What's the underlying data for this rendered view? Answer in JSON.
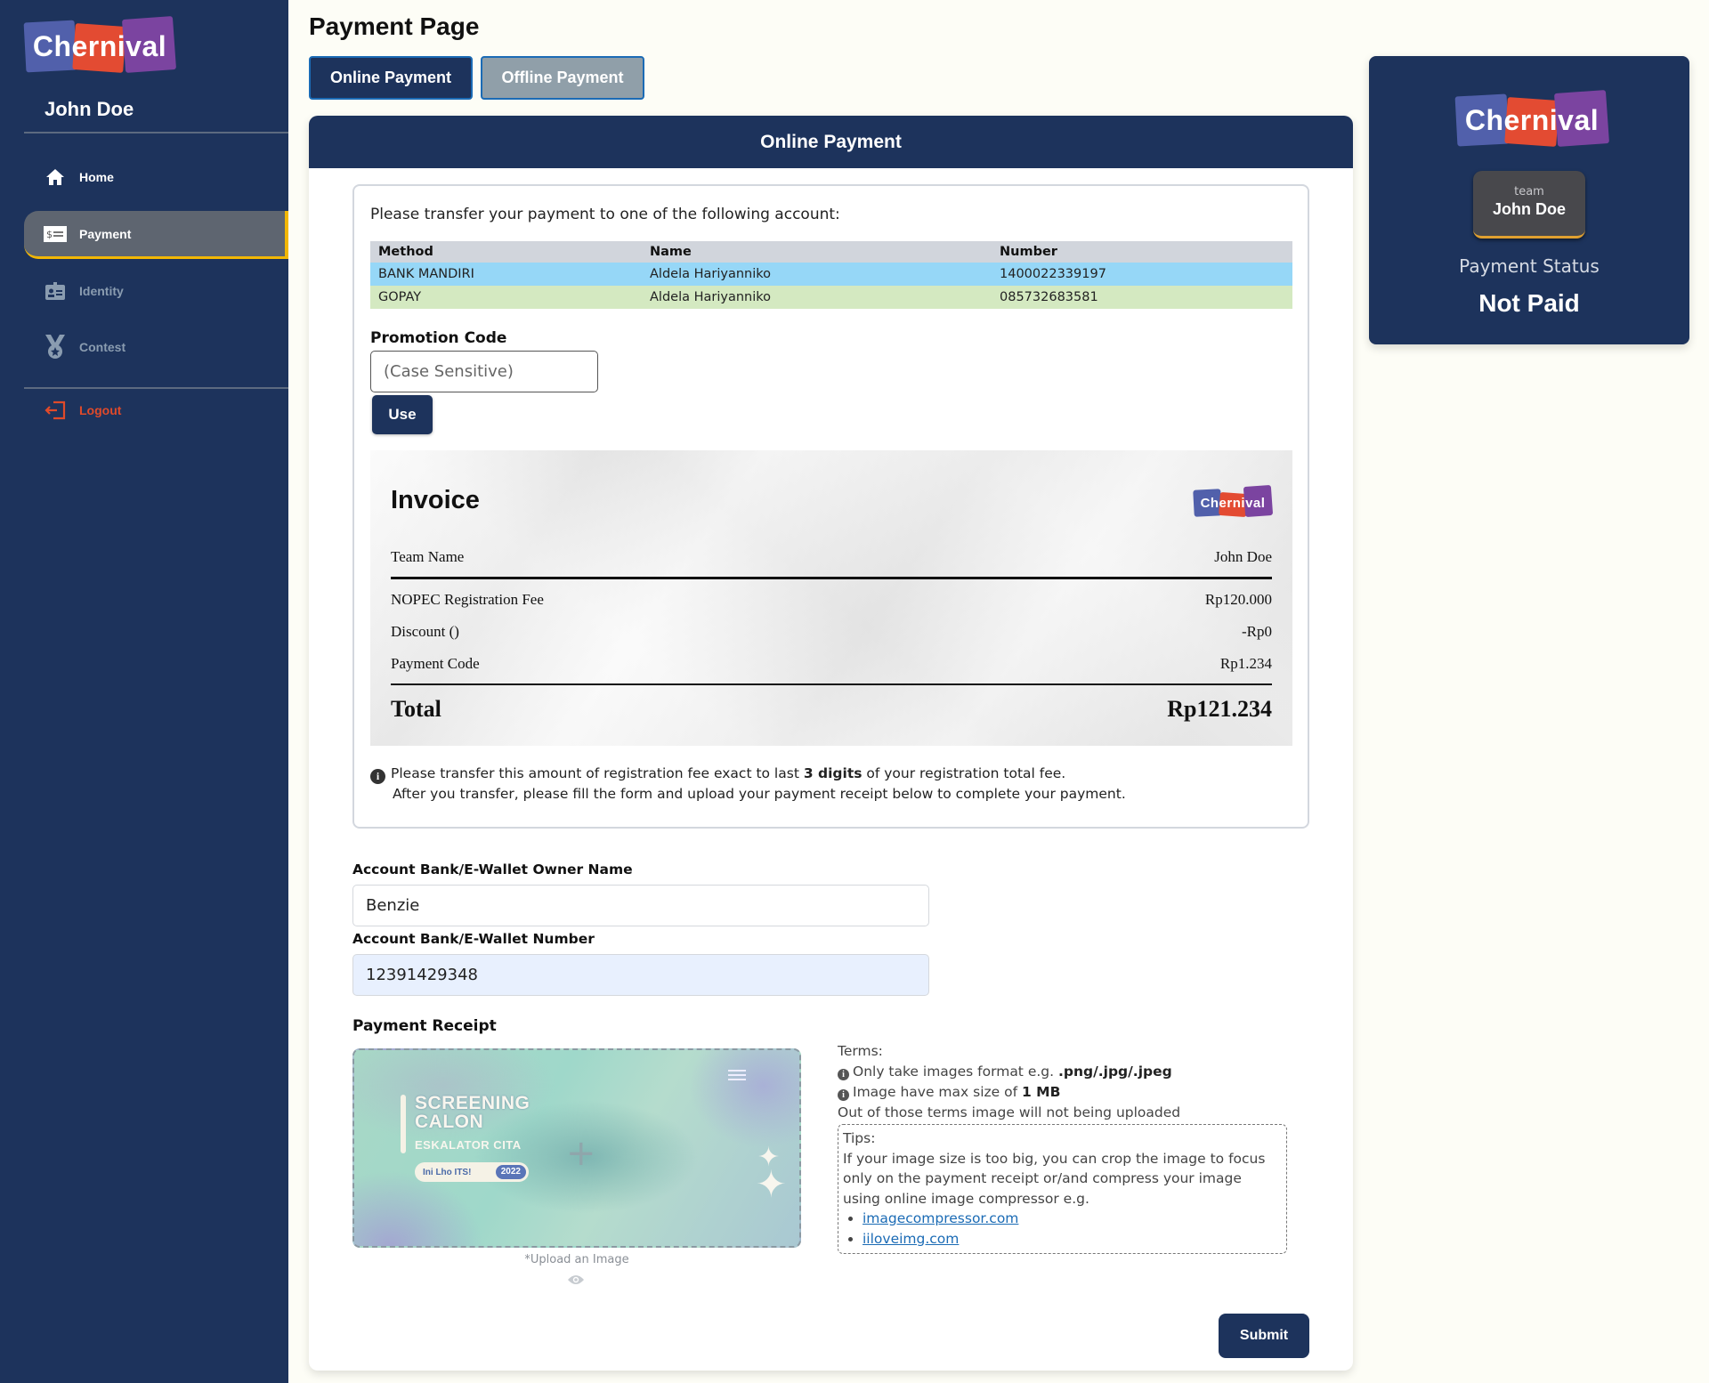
{
  "app": {
    "brand": "Chernival"
  },
  "sidebar": {
    "user_name": "John Doe",
    "items": [
      {
        "label": "Home",
        "icon": "home-icon"
      },
      {
        "label": "Payment",
        "icon": "payment-card-icon",
        "active": true
      },
      {
        "label": "Identity",
        "icon": "id-card-icon"
      },
      {
        "label": "Contest",
        "icon": "medal-icon"
      }
    ],
    "logout_label": "Logout"
  },
  "header": {
    "title": "Payment Page",
    "tabs": [
      {
        "label": "Online Payment",
        "active": true
      },
      {
        "label": "Offline Payment",
        "active": false
      }
    ]
  },
  "card": {
    "title": "Online Payment",
    "intro": "Please transfer your payment to one of the following account:",
    "accounts": {
      "columns": [
        "Method",
        "Name",
        "Number"
      ],
      "rows": [
        [
          "BANK MANDIRI",
          "Aldela Hariyanniko",
          "1400022339197"
        ],
        [
          "GOPAY",
          "Aldela Hariyanniko",
          "085732683581"
        ]
      ]
    },
    "promo": {
      "label": "Promotion Code",
      "placeholder": "(Case Sensitive)",
      "value": "",
      "button": "Use"
    },
    "invoice": {
      "title": "Invoice",
      "team_label": "Team Name",
      "team_value": "John Doe",
      "lines": [
        {
          "label": "NOPEC Registration Fee",
          "value": "Rp120.000"
        },
        {
          "label": "Discount ()",
          "value": "-Rp0"
        },
        {
          "label": "Payment Code",
          "value": "Rp1.234"
        }
      ],
      "total_label": "Total",
      "total_value": "Rp121.234"
    },
    "note": {
      "line1_pre": "Please transfer this amount of registration fee exact to last ",
      "line1_bold": "3 digits",
      "line1_post": " of your registration total fee.",
      "line2": "After you transfer, please fill the form and upload your payment receipt below to complete your payment."
    },
    "form": {
      "owner_label": "Account Bank/E-Wallet Owner Name",
      "owner_value": "Benzie",
      "number_label": "Account Bank/E-Wallet Number",
      "number_value": "12391429348",
      "receipt_label": "Payment Receipt",
      "receipt_preview": {
        "title_line1": "SCREENING",
        "title_line2": "CALON",
        "subtitle": "ESKALATOR CITA",
        "pill_text": "Ini Lho ITS!",
        "pill_year": "2022"
      },
      "upload_caption": "*Upload an Image",
      "submit": "Submit"
    },
    "terms": {
      "heading": "Terms:",
      "item1_pre": "Only take images format e.g. ",
      "item1_bold": ".png/.jpg/.jpeg",
      "item2_pre": "Image have max size of ",
      "item2_bold": "1 MB",
      "footer": "Out of those terms image will not being uploaded",
      "tips_heading": "Tips:",
      "tips_text": "If your image size is too big, you can crop the image to focus only on the payment receipt or/and compress your image using online image compressor e.g.",
      "links": [
        "imagecompressor.com",
        "iiloveimg.com"
      ]
    }
  },
  "status_panel": {
    "team_caption": "team",
    "team_name": "John Doe",
    "status_label": "Payment Status",
    "status_value": "Not Paid"
  },
  "colors": {
    "navy": "#1d335c",
    "accent_yellow": "#f2b705",
    "logout_red": "#e04a2a",
    "row_bank": "#96d7f7",
    "row_gopay": "#d4e9c1",
    "link": "#1b6bb5"
  }
}
